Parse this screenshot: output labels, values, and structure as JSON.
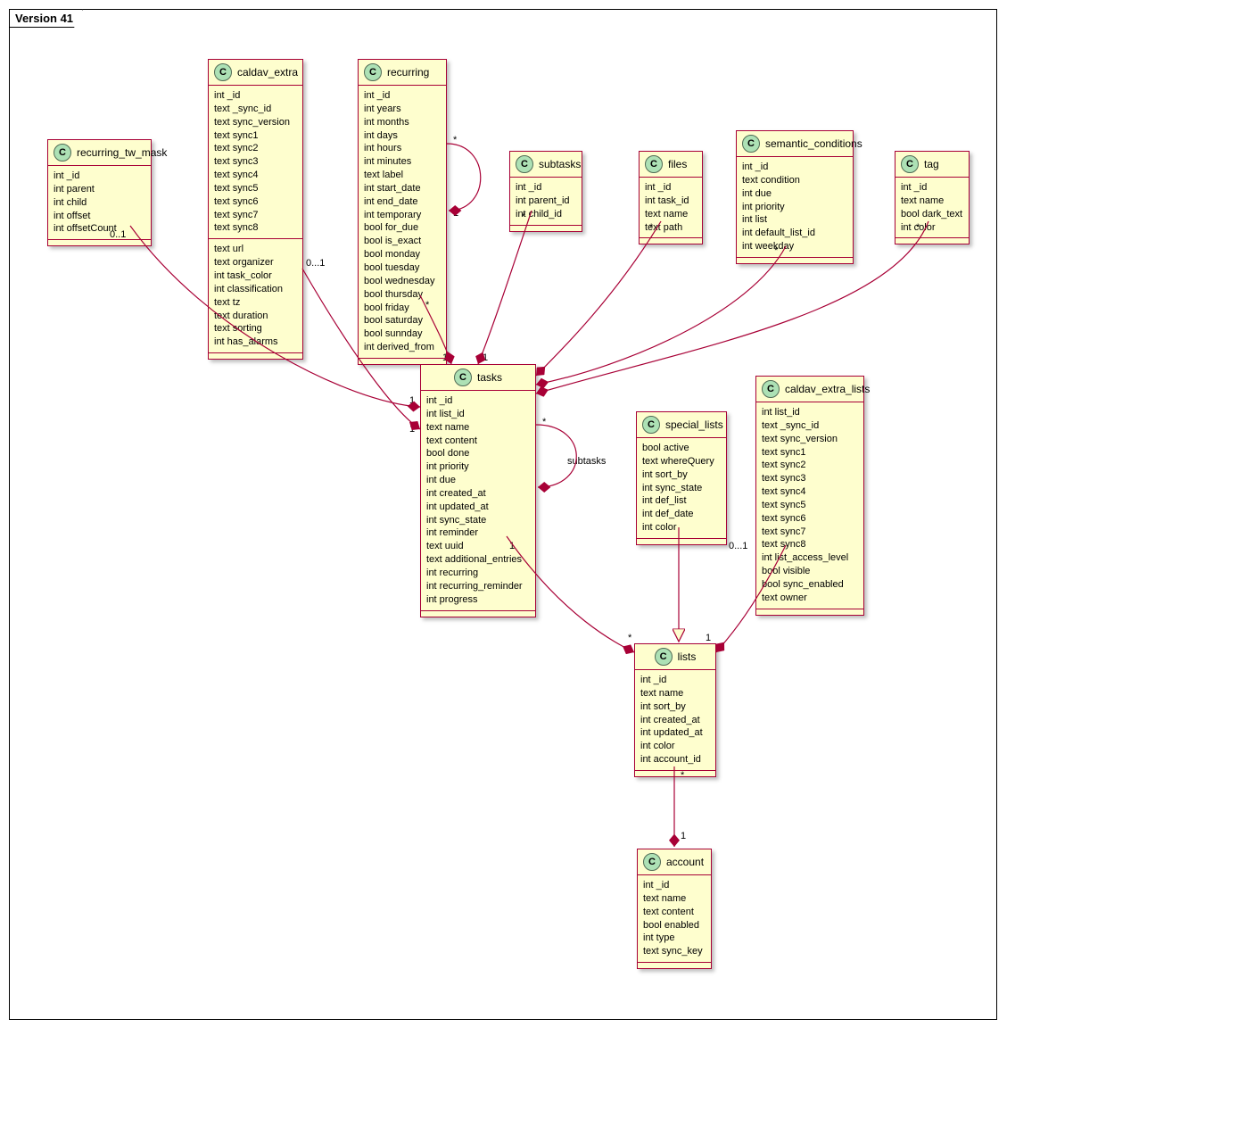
{
  "frame_title": "Version 41",
  "classes": {
    "recurring_tw_mask": {
      "title": "recurring_tw_mask",
      "fields": [
        "int _id",
        "int parent",
        "int child",
        "int offset",
        "int offsetCount"
      ]
    },
    "caldav_extra": {
      "title": "caldav_extra",
      "fields1": [
        "int _id",
        "text _sync_id",
        "text sync_version",
        "text sync1",
        "text sync2",
        "text sync3",
        "text sync4",
        "text sync5",
        "text sync6",
        "text sync7",
        "text sync8"
      ],
      "fields2": [
        "text url",
        "text organizer",
        "int task_color",
        "int classification",
        "text tz",
        "text duration",
        "text sorting",
        "int has_alarms"
      ]
    },
    "recurring": {
      "title": "recurring",
      "fields": [
        "int _id",
        "int years",
        "int months",
        "int days",
        "int hours",
        "int minutes",
        "text label",
        "int start_date",
        "int end_date",
        "int temporary",
        "bool for_due",
        "bool is_exact",
        "bool monday",
        "bool tuesday",
        "bool wednesday",
        "bool thursday",
        "bool friday",
        "bool saturday",
        "bool sunnday",
        "int derived_from"
      ]
    },
    "subtasks": {
      "title": "subtasks",
      "fields": [
        "int _id",
        "int parent_id",
        "int child_id"
      ]
    },
    "files": {
      "title": "files",
      "fields": [
        "int _id",
        "int task_id",
        "text name",
        "text path"
      ]
    },
    "semantic_conditions": {
      "title": "semantic_conditions",
      "fields": [
        "int _id",
        "text condition",
        "int due",
        "int priority",
        "int list",
        "int default_list_id",
        "int weekday"
      ]
    },
    "tag": {
      "title": "tag",
      "fields": [
        "int _id",
        "text name",
        "bool dark_text",
        "int color"
      ]
    },
    "tasks": {
      "title": "tasks",
      "fields": [
        "int _id",
        "int list_id",
        "text name",
        "text content",
        "bool done",
        "int priority",
        "int due",
        "int created_at",
        "int updated_at",
        "int sync_state",
        "int reminder",
        "text uuid",
        "text additional_entries",
        "int recurring",
        "int recurring_reminder",
        "int progress"
      ]
    },
    "special_lists": {
      "title": "special_lists",
      "fields": [
        "bool active",
        "text whereQuery",
        "int sort_by",
        "int sync_state",
        "int def_list",
        "int def_date",
        "int color"
      ]
    },
    "caldav_extra_lists": {
      "title": "caldav_extra_lists",
      "fields": [
        "int list_id",
        "text _sync_id",
        "text sync_version",
        "text sync1",
        "text sync2",
        "text sync3",
        "text sync4",
        "text sync5",
        "text sync6",
        "text sync7",
        "text sync8",
        "int list_access_level",
        "bool visible",
        "bool sync_enabled",
        "text owner"
      ]
    },
    "lists": {
      "title": "lists",
      "fields": [
        "int _id",
        "text name",
        "int sort_by",
        "int created_at",
        "int updated_at",
        "int color",
        "int account_id"
      ]
    },
    "account": {
      "title": "account",
      "fields": [
        "int _id",
        "text name",
        "text content",
        "bool enabled",
        "int type",
        "text sync_key"
      ]
    }
  },
  "multiplicities": {
    "rtw_top": "0..1",
    "caldav_top": "0...1",
    "recurring_self_top": "*",
    "recurring_self_bot": "1",
    "recurring_tasks_top": "*",
    "recurring_tasks_bot": "1",
    "subtasks_top": "*",
    "files_top": "*",
    "sem_top": "*",
    "tag_top": "*",
    "tasks_self_top": "*",
    "tasks_self_bot": "*",
    "tasks_self_label": "subtasks",
    "tasks_left_1a": "1",
    "tasks_left_1b": "1",
    "tasks_top_1": "1",
    "tasks_lists_top": "1",
    "tasks_lists_bot": "*",
    "caldav_lists_top": "0...1",
    "caldav_lists_bot": "1",
    "lists_account_top": "*",
    "lists_account_bot": "1"
  }
}
